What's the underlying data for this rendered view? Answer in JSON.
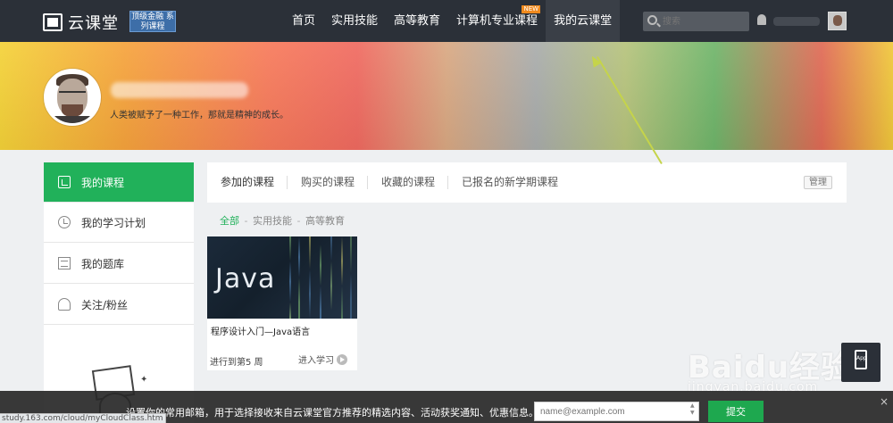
{
  "header": {
    "logo_text": "云课堂",
    "promo_badge": "顶级金融 系列课程",
    "nav": [
      {
        "label": "首页"
      },
      {
        "label": "实用技能"
      },
      {
        "label": "高等教育"
      },
      {
        "label": "计算机专业课程",
        "badge": "NEW"
      },
      {
        "label": "我的云课堂",
        "active": true
      }
    ],
    "search_placeholder": "搜索",
    "icons": [
      "search-icon",
      "bell-icon"
    ]
  },
  "profile": {
    "motto": "人类被赋予了一种工作，那就是精神的成长。"
  },
  "sidebar": {
    "items": [
      {
        "label": "我的课程",
        "icon": "book-icon",
        "active": true
      },
      {
        "label": "我的学习计划",
        "icon": "clock-icon"
      },
      {
        "label": "我的题库",
        "icon": "quiz-icon"
      },
      {
        "label": "关注/粉丝",
        "icon": "person-icon"
      }
    ]
  },
  "main": {
    "tabs": [
      {
        "label": "参加的课程",
        "active": true
      },
      {
        "label": "购买的课程"
      },
      {
        "label": "收藏的课程"
      },
      {
        "label": "已报名的新学期课程"
      }
    ],
    "manage_label": "管理",
    "filters": [
      {
        "label": "全部",
        "active": true
      },
      {
        "label": "实用技能"
      },
      {
        "label": "高等教育"
      }
    ],
    "filter_separator": "-",
    "course": {
      "thumb_text": "Java",
      "title": "程序设计入门—Java语言",
      "progress": "进行到第5 周",
      "enter_label": "进入学习"
    }
  },
  "app_button_label": "App",
  "watermark": {
    "brand": "Baidu经验",
    "url": "jingyan.baidu.com"
  },
  "bottom_bar": {
    "text": "设置你的常用邮箱，用于选择接收来自云课堂官方推荐的精选内容、活动获奖通知、优惠信息。",
    "email_placeholder": "name@example.com",
    "submit_label": "提交",
    "close_symbol": "×"
  },
  "status_url": "study.163.com/cloud/myCloudClass.htm",
  "colors": {
    "accent_green": "#21b15a",
    "topbar": "#2b3038",
    "new_badge": "#f08a1e"
  }
}
